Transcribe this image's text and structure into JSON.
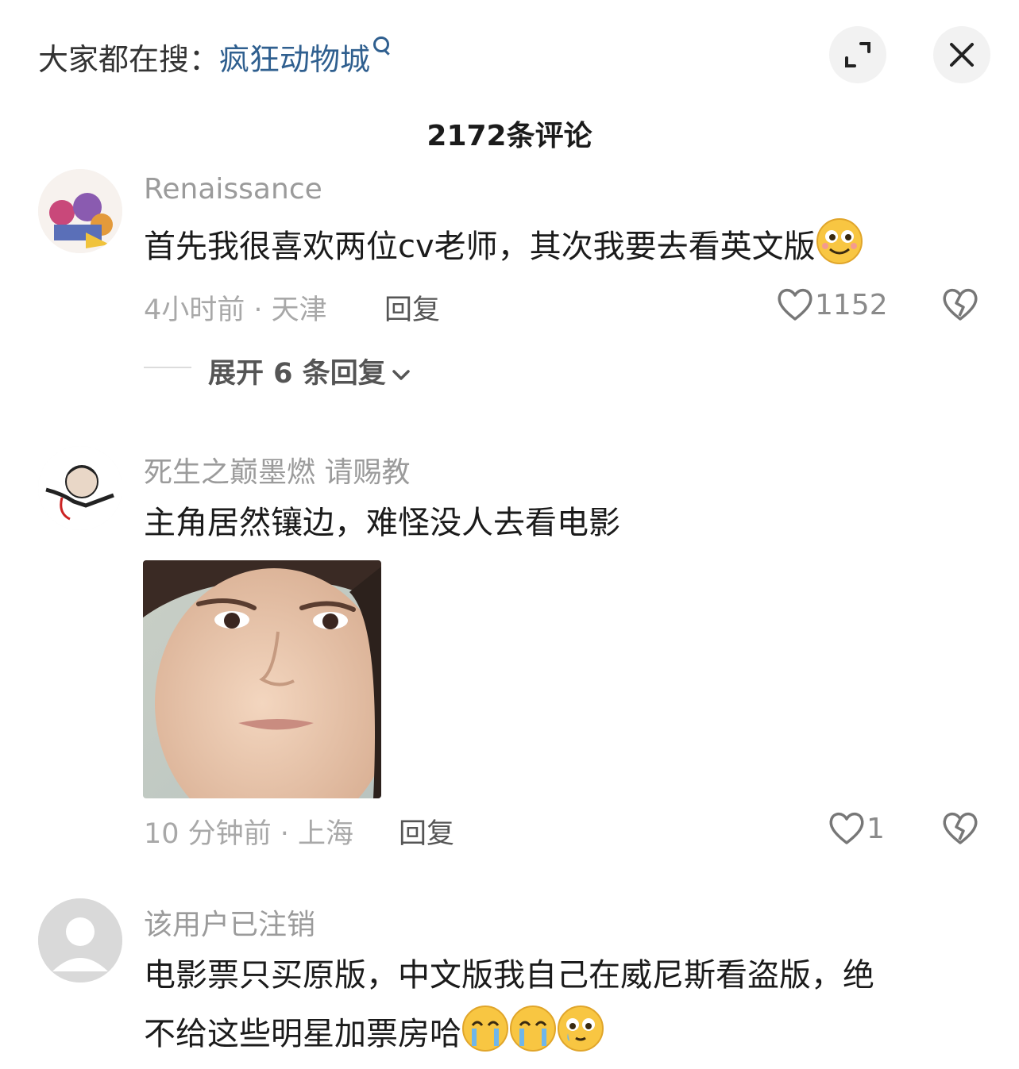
{
  "header": {
    "search_prefix": "大家都在搜：",
    "search_term": "疯狂动物城",
    "comment_count_title": "2172条评论"
  },
  "comments": [
    {
      "username": "Renaissance",
      "text": "首先我很喜欢两位cv老师，其次我要去看英文版",
      "meta": "4小时前 · 天津",
      "reply_label": "回复",
      "likes": "1152",
      "expand_label": "展开 6 条回复"
    },
    {
      "username": "死生之巅墨燃 请赐教",
      "text": "主角居然镶边，难怪没人去看电影",
      "meta": "10 分钟前 · 上海",
      "reply_label": "回复",
      "likes": "1"
    },
    {
      "username": "该用户已注销",
      "text_line1": "电影票只买原版，中文版我自己在威尼斯看盗版，绝",
      "text_line2": "不给这些明星加票房哈"
    }
  ],
  "colors": {
    "accent": "#2f5f8f",
    "muted": "#a8a8a8",
    "text": "#1b1b1b"
  }
}
